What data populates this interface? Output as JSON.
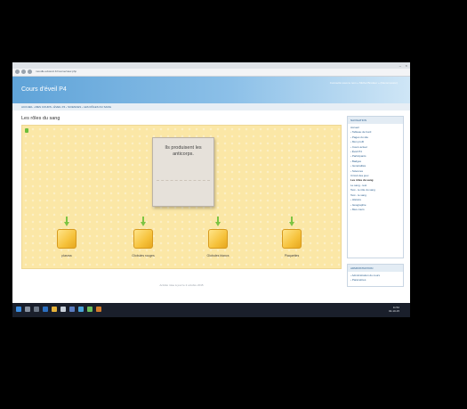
{
  "browser": {
    "url": "moodle.eduscol.fr/course/view.php"
  },
  "header": {
    "site_title": "Cours d'éveil P4",
    "login_info": "Connecté sous le nom « Michel Brodeur » (Déconnexion)"
  },
  "breadcrumb": {
    "text": "ACCUEIL › MES COURS › ÉVEIL P4 › SCIENCES › LES RÔLES DU SANG"
  },
  "main": {
    "page_title": "Les rôles du sang",
    "card_text": "Ils produisent les anticorps.",
    "targets": [
      {
        "label": "plasma"
      },
      {
        "label": "Globules rouges"
      },
      {
        "label": "Globules blancs"
      },
      {
        "label": "Plaquettes"
      }
    ],
    "footer_note": "Activité mise à jour le 2 octobre 2015"
  },
  "sidebar": {
    "navigation": {
      "title": "NAVIGATION",
      "items": [
        {
          "label": "Accueil",
          "bold": false
        },
        {
          "label": "› Tableau de bord",
          "bold": false
        },
        {
          "label": "› Pages du site",
          "bold": false
        },
        {
          "label": "› Mon profil",
          "bold": false
        },
        {
          "label": "› Cours actuel",
          "bold": false
        },
        {
          "label": "› Éveil P4",
          "bold": false
        },
        {
          "label": "› Participants",
          "bold": false
        },
        {
          "label": "› Badges",
          "bold": false
        },
        {
          "label": "› Généralités",
          "bold": false
        },
        {
          "label": "› Sciences",
          "bold": false
        },
        {
          "label": "Circuit des jeux",
          "bold": false
        },
        {
          "label": "Les rôles du sang",
          "bold": true
        },
        {
          "label": "Le sang - test",
          "bold": false
        },
        {
          "label": "Test - le rôle du sang",
          "bold": false
        },
        {
          "label": "Test - le sang",
          "bold": false
        },
        {
          "label": "› Histoire",
          "bold": false
        },
        {
          "label": "› Géographie",
          "bold": false
        },
        {
          "label": "› Mes cours",
          "bold": false
        }
      ]
    },
    "administration": {
      "title": "ADMINISTRATION",
      "items": [
        {
          "label": "› Administration du cours"
        },
        {
          "label": "› Paramètres"
        }
      ]
    }
  },
  "taskbar": {
    "time": "11:52",
    "date": "02-10-15"
  }
}
